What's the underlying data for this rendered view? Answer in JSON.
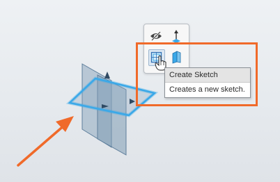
{
  "viewport": {
    "plane_color": "#3aa8e8",
    "origin_plane_color": "#8fa9bf",
    "annotation_color": "#f06a2a"
  },
  "toolbar": {
    "items": [
      {
        "icon": "eye-visibility-icon"
      },
      {
        "icon": "axis-direction-icon"
      },
      {
        "icon": "create-sketch-icon"
      },
      {
        "icon": "offset-plane-icon"
      }
    ]
  },
  "tooltip": {
    "title": "Create Sketch",
    "description": "Creates a new sketch."
  }
}
